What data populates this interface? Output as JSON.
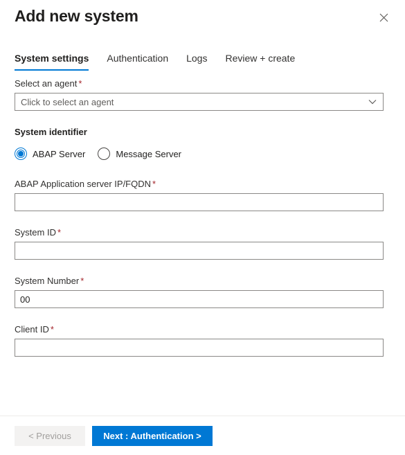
{
  "header": {
    "title": "Add new system",
    "close_icon": "close-icon"
  },
  "tabs": [
    {
      "label": "System settings",
      "active": true
    },
    {
      "label": "Authentication",
      "active": false
    },
    {
      "label": "Logs",
      "active": false
    },
    {
      "label": "Review + create",
      "active": false
    }
  ],
  "form": {
    "agent": {
      "label": "Select an agent",
      "required_marker": "*",
      "placeholder": "Click to select an agent",
      "value": "",
      "chevron_icon": "chevron-down-icon"
    },
    "system_identifier": {
      "label": "System identifier",
      "options": [
        {
          "label": "ABAP Server",
          "selected": true
        },
        {
          "label": "Message Server",
          "selected": false
        }
      ]
    },
    "fields": [
      {
        "name": "abap-application-server-ip-fqdn",
        "label": "ABAP Application server IP/FQDN",
        "required_marker": "*",
        "value": "",
        "placeholder": ""
      },
      {
        "name": "system-id",
        "label": "System ID",
        "required_marker": "*",
        "value": "",
        "placeholder": ""
      },
      {
        "name": "system-number",
        "label": "System Number",
        "required_marker": "*",
        "value": "00",
        "placeholder": ""
      },
      {
        "name": "client-id",
        "label": "Client ID",
        "required_marker": "*",
        "value": "",
        "placeholder": ""
      }
    ]
  },
  "footer": {
    "previous_label": "< Previous",
    "next_label": "Next : Authentication >"
  },
  "colors": {
    "accent": "#0078d4",
    "required_asterisk": "#a4262c",
    "text_primary": "#201f1e",
    "text_secondary": "#605e5c",
    "border": "#8a8886",
    "disabled_bg": "#f3f2f1",
    "disabled_text": "#a19f9d"
  }
}
